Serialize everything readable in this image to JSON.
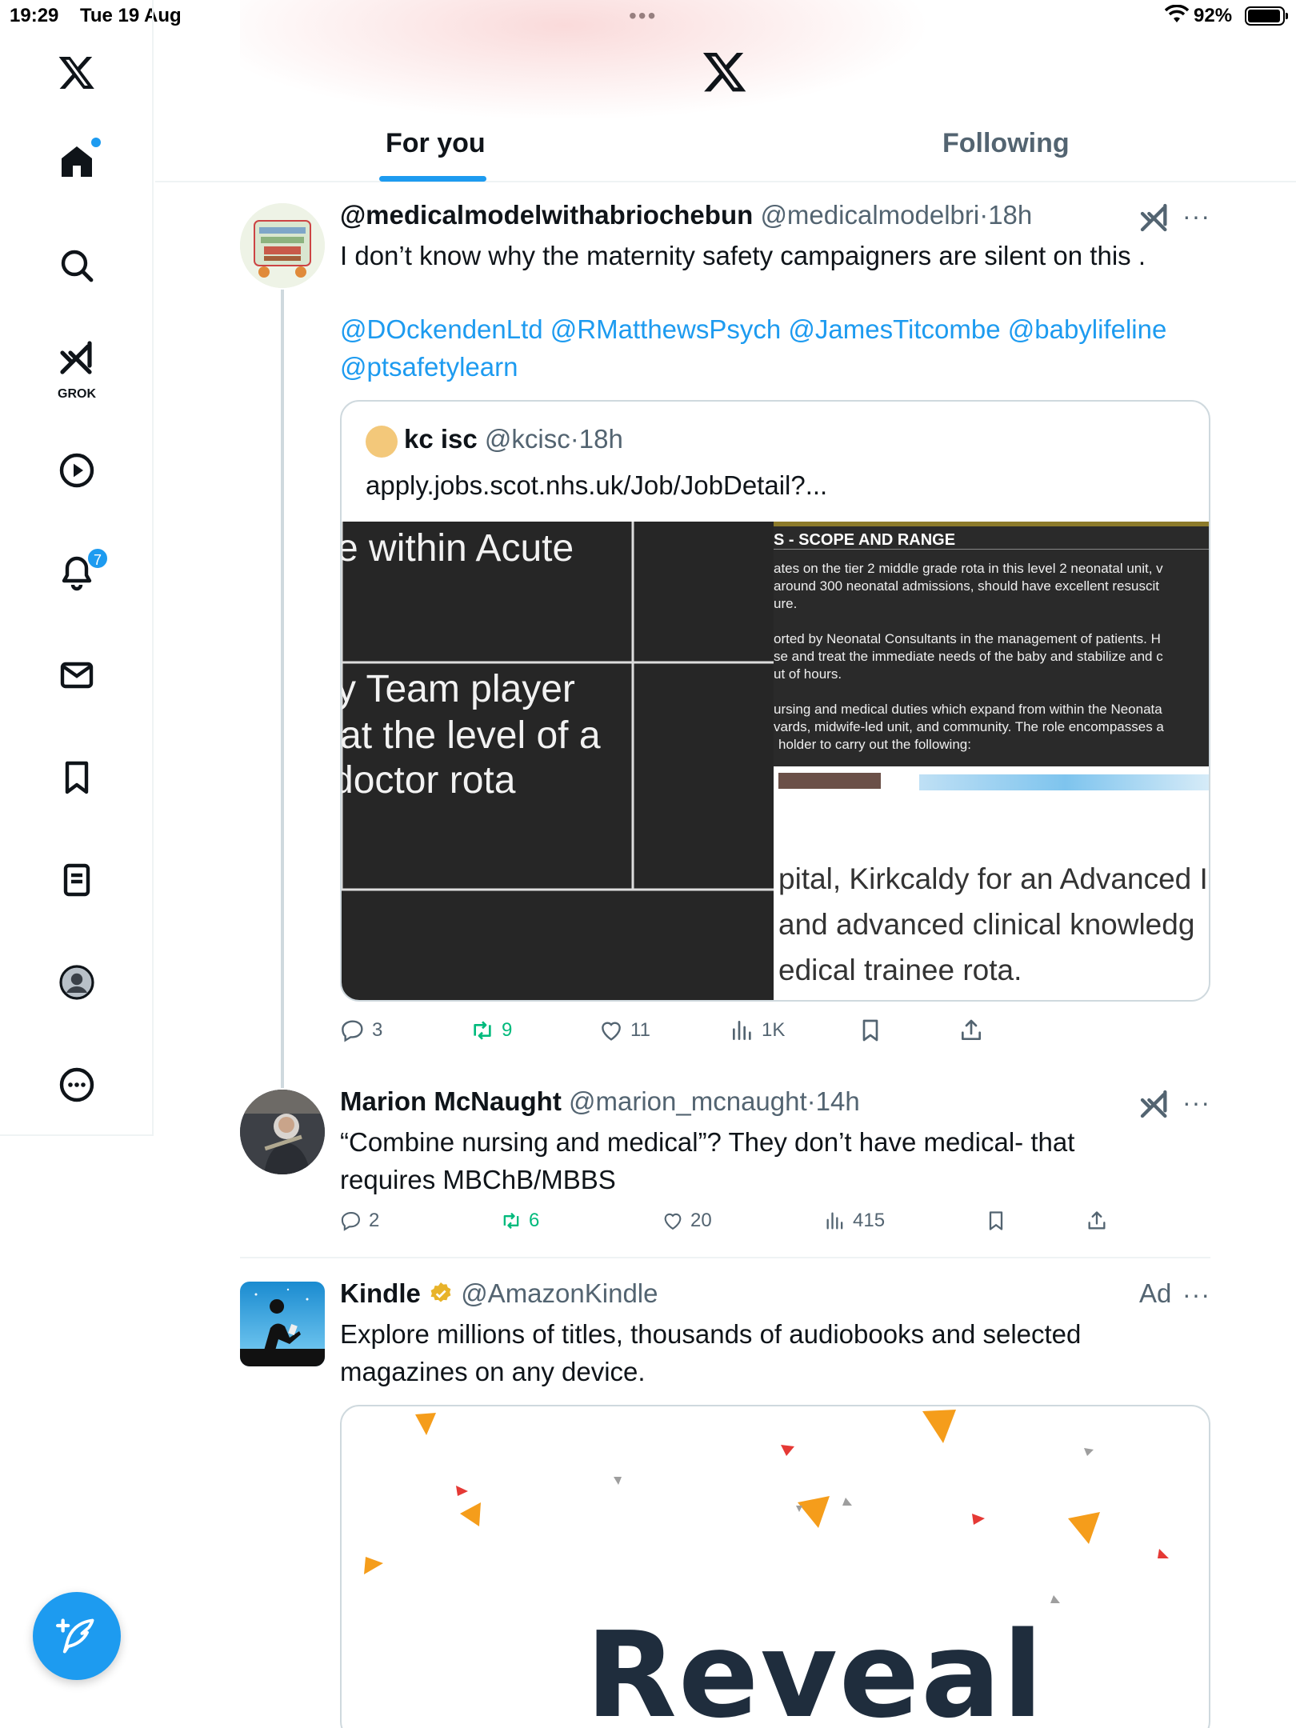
{
  "status_bar": {
    "time": "19:29",
    "date": "Tue 19 Aug",
    "dots": "•••",
    "battery": "92%"
  },
  "sidebar": {
    "grok_label": "GROK",
    "notifications_count": "7"
  },
  "tabs": [
    {
      "label": "For you",
      "active": true
    },
    {
      "label": "Following",
      "active": false
    }
  ],
  "tweets": [
    {
      "name": "@medicalmodelwithabriochebun",
      "handle": "@medicalmodelbri",
      "sep": "·",
      "time": "18h",
      "more": "···",
      "text": "I don’t know why the maternity safety campaigners are silent on this .",
      "mentions_line1": "@DOckendenLtd @RMatthewsPsych @JamesTitcombe @babylifeline",
      "mentions_line2": "@ptsafetylearn",
      "quote": {
        "name": "kc isc",
        "handle": "@kcisc",
        "sep": "·",
        "time": "18h",
        "text": "apply.jobs.scot.nhs.uk/Job/JobDetail?...",
        "image_left": {
          "line1": "e within Acute",
          "line2": "y Team player",
          "line3": "at the level of a",
          "line4": "doctor rota"
        },
        "image_right": {
          "heading": "S - SCOPE AND RANGE",
          "p1a": "ates on the tier 2 middle grade rota in this level 2 neonatal unit, v",
          "p1b": "around 300 neonatal admissions, should have excellent resuscit",
          "p1c": "ure.",
          "p2a": "orted by Neonatal Consultants in the management of patients. H",
          "p2b": "se and treat the immediate needs of the baby and stabilize and c",
          "p2c": "ut of hours.",
          "p3a": "ursing and medical duties which expand from within the Neonata",
          "p3b": "vards, midwife-led unit, and community. The role encompasses a",
          "p3c": "holder to carry out the following:",
          "bottom1": "pital, Kirkcaldy for an Advanced I",
          "bottom2": "and advanced clinical knowledg",
          "bottom3": "edical trainee rota."
        }
      },
      "stats": {
        "replies": "3",
        "reposts": "9",
        "likes": "11",
        "views": "1K"
      }
    },
    {
      "name": "Marion McNaught",
      "handle": "@marion_mcnaught",
      "sep": "·",
      "time": "14h",
      "more": "···",
      "text_line1": "“Combine nursing and medical”? They don’t have medical- that",
      "text_line2": "requires MBChB/MBBS",
      "stats": {
        "replies": "2",
        "reposts": "6",
        "likes": "20",
        "views": "415"
      }
    },
    {
      "name": "Kindle",
      "handle": "@AmazonKindle",
      "ad": "Ad",
      "more": "···",
      "text_line1": "Explore millions of titles, thousands of audiobooks and selected",
      "text_line2": "magazines on any device.",
      "card_title": "Reveal"
    }
  ],
  "colors": {
    "accent": "#1d9bf0",
    "retweet": "#00ba7c",
    "muted": "#536471",
    "text": "#0f1419"
  },
  "icons": [
    "x-logo-icon",
    "home-icon",
    "search-icon",
    "grok-icon",
    "video-icon",
    "notifications-icon",
    "messages-icon",
    "bookmarks-icon",
    "lists-icon",
    "profile-icon",
    "more-icon",
    "compose-icon",
    "reply-icon",
    "repost-icon",
    "like-icon",
    "views-icon",
    "bookmark-icon",
    "share-icon",
    "verified-icon"
  ]
}
